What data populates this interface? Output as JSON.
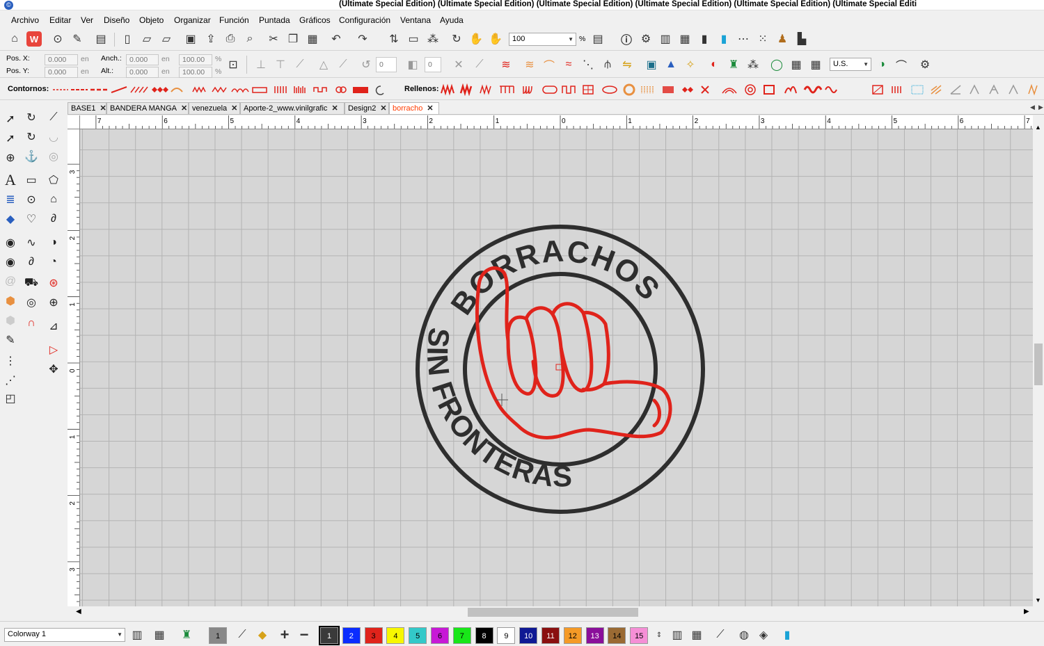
{
  "window": {
    "title": "(Ultimate Special Edition) (Ultimate Special Edition) (Ultimate Special Edition) (Ultimate Special Edition) (Ultimate Special Edition) (Ultimate Special Editi"
  },
  "menu": {
    "items": [
      "Archivo",
      "Editar",
      "Ver",
      "Diseño",
      "Objeto",
      "Organizar",
      "Función",
      "Puntada",
      "Gráficos",
      "Configuración",
      "Ventana",
      "Ayuda"
    ]
  },
  "toolbar": {
    "zoom_value": "100",
    "zoom_unit": "%"
  },
  "position_bar": {
    "pos_x_label": "Pos. X:",
    "pos_y_label": "Pos. Y:",
    "pos_x_value": "0.000",
    "pos_y_value": "0.000",
    "width_label": "Anch.:",
    "height_label": "Alt.:",
    "width_value": "0.000",
    "height_value": "0.000",
    "unit": "en",
    "width_pct": "100.00",
    "height_pct": "100.00",
    "pct_sign": "%",
    "rotate_value": "0",
    "slant_value": "0",
    "units_select": "U.S."
  },
  "stitch_bar": {
    "outlines_label": "Contornos:",
    "fills_label": "Rellenos:"
  },
  "tabs": [
    {
      "label": "BASE1",
      "active": false
    },
    {
      "label": "BANDERA MANGA",
      "active": false
    },
    {
      "label": "venezuela",
      "active": false
    },
    {
      "label": "Aporte-2_www.vinilgrafic",
      "active": false
    },
    {
      "label": "Design2",
      "active": false
    },
    {
      "label": "borracho",
      "active": true
    }
  ],
  "rulers": {
    "horizontal": [
      "7",
      "6",
      "5",
      "4",
      "3",
      "2",
      "1",
      "0",
      "1",
      "2",
      "3",
      "4",
      "5",
      "6",
      "7"
    ],
    "vertical": [
      "3",
      "2",
      "1",
      "0",
      "1",
      "2",
      "3"
    ]
  },
  "design": {
    "top_text": "BORRACHOS",
    "bottom_text": "SIN FRONTERAS",
    "ring_color": "#2e2e2e",
    "hand_color": "#e0231b"
  },
  "colorway": {
    "value": "Colorway 1"
  },
  "palette": {
    "active_thread": "1",
    "threads": [
      {
        "num": "1",
        "color": "#3a3a3a",
        "text": "#ffffff"
      },
      {
        "num": "2",
        "color": "#0a2cff",
        "text": "#ffffff"
      },
      {
        "num": "3",
        "color": "#e0231b",
        "text": "#000000"
      },
      {
        "num": "4",
        "color": "#f7f700",
        "text": "#000000"
      },
      {
        "num": "5",
        "color": "#33c9c9",
        "text": "#000000"
      },
      {
        "num": "6",
        "color": "#c719d6",
        "text": "#000000"
      },
      {
        "num": "7",
        "color": "#19e619",
        "text": "#000000"
      },
      {
        "num": "8",
        "color": "#000000",
        "text": "#ffffff"
      },
      {
        "num": "9",
        "color": "#ffffff",
        "text": "#000000"
      },
      {
        "num": "10",
        "color": "#0f1994",
        "text": "#ffffff"
      },
      {
        "num": "11",
        "color": "#8a1010",
        "text": "#ffffff"
      },
      {
        "num": "12",
        "color": "#f59a26",
        "text": "#000000"
      },
      {
        "num": "13",
        "color": "#8a0f9a",
        "text": "#ffffff"
      },
      {
        "num": "14",
        "color": "#9a6a33",
        "text": "#000000"
      },
      {
        "num": "15",
        "color": "#f58fd6",
        "text": "#000000"
      }
    ]
  }
}
